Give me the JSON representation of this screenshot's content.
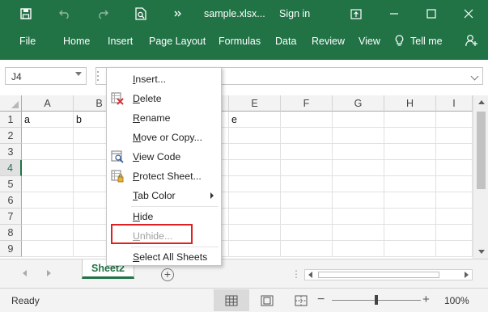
{
  "titlebar": {
    "title": "sample.xlsx...",
    "sign_in": "Sign in",
    "icons": [
      "save-icon",
      "undo-icon",
      "redo-icon",
      "print-preview-icon",
      "more-commands-icon",
      "ribbon-display-icon",
      "minimize-icon",
      "maximize-icon",
      "close-icon"
    ]
  },
  "ribbon": {
    "tabs": [
      {
        "label": "File"
      },
      {
        "label": "Home"
      },
      {
        "label": "Insert"
      },
      {
        "label": "Page Layout"
      },
      {
        "label": "Formulas"
      },
      {
        "label": "Data"
      },
      {
        "label": "Review"
      },
      {
        "label": "View"
      },
      {
        "label": "Tell me"
      }
    ]
  },
  "formula_bar": {
    "name_box": "J4",
    "formula": ""
  },
  "grid": {
    "columns": [
      "A",
      "B",
      "",
      "",
      "E",
      "F",
      "G",
      "H",
      "I"
    ],
    "rows": [
      "1",
      "2",
      "3",
      "4",
      "5",
      "6",
      "7",
      "8",
      "9"
    ],
    "selected_row": "4",
    "cells": {
      "A1": "a",
      "B1": "b",
      "E1": "e"
    }
  },
  "context_menu": {
    "items": [
      {
        "label": "Insert...",
        "underline": "I",
        "rest": "nsert...",
        "enabled": true,
        "icon": "none"
      },
      {
        "label": "Delete",
        "underline": "D",
        "rest": "elete",
        "enabled": true,
        "icon": "delete-sheet-icon"
      },
      {
        "label": "Rename",
        "underline": "R",
        "rest": "ename",
        "enabled": true,
        "icon": "none"
      },
      {
        "label": "Move or Copy...",
        "underline": "M",
        "rest": "ove or Copy...",
        "enabled": true,
        "icon": "none"
      },
      {
        "label": "View Code",
        "underline": "V",
        "rest": "iew Code",
        "enabled": true,
        "icon": "view-code-icon"
      },
      {
        "label": "Protect Sheet...",
        "underline": "P",
        "rest": "rotect Sheet...",
        "enabled": true,
        "icon": "protect-sheet-icon"
      },
      {
        "label": "Tab Color",
        "underline": "T",
        "rest": "ab Color",
        "enabled": true,
        "icon": "none",
        "submenu": true
      },
      {
        "label": "Hide",
        "underline": "H",
        "rest": "ide",
        "enabled": true,
        "icon": "none"
      },
      {
        "label": "Unhide...",
        "underline": "U",
        "rest": "nhide...",
        "enabled": false,
        "icon": "none"
      },
      {
        "label": "Select All Sheets",
        "underline": "S",
        "rest": "elect All Sheets",
        "enabled": true,
        "icon": "none"
      }
    ],
    "highlighted_item": "Unhide..."
  },
  "sheets": {
    "tabs": [
      "Sheet2"
    ],
    "active": "Sheet2"
  },
  "status": {
    "ready": "Ready",
    "zoom": "100%",
    "zoom_percent": 100
  },
  "colors": {
    "brand": "#217346",
    "highlight": "#e02020"
  }
}
